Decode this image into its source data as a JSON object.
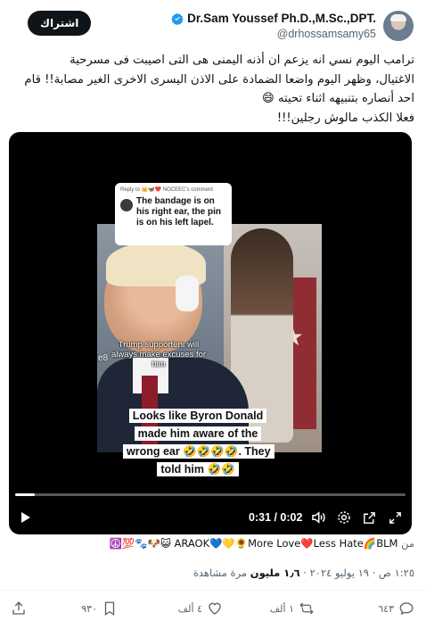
{
  "author": {
    "display_name": "Dr.Sam Youssef Ph.D.,M.Sc.,DPT.",
    "handle": "@drhossamsamy65",
    "verified_color": "#1d9bf0"
  },
  "subscribe_label": "اشتراك",
  "tweet": {
    "lines": [
      "ترامب اليوم نسي انه يزعم ان أذنه اليمنى هى التى اصيبت فى مسرحية",
      "الاغتيال، وظهر اليوم واضعا الضمادة على الاذن اليسرى الاخرى الغير مصابة!! قام",
      "احد أنصاره بتنبيهه اثناء تحيته 😄",
      "فعلا الكذب مالوش رجلين!!!"
    ]
  },
  "video": {
    "reply_header": "Reply to 👑🦋❤️ NOCEEC's comment",
    "reply_text": "The bandage is on his right ear, the pin is on his left lapel.",
    "caption_top": "Trump supporters will always make excuses for him",
    "caption_fragment": "e8",
    "caption_bottom": "Looks like Byron Donald made him aware of the wrong ear 🤣🤣🤣🤣. They told him 🤣🤣",
    "time_display": "0:31 / 0:02",
    "progress_fraction": 0.05,
    "controls": [
      "play-icon",
      "volume-icon",
      "settings-icon",
      "external-link-icon",
      "fullscreen-icon"
    ]
  },
  "source": {
    "prefix": "من",
    "account_label": "☮️💯🐾🐶😺 ARAOK💙💛🌻More Love❤️Less Hate🌈BLM"
  },
  "meta": {
    "time": "١:٢٥ ص",
    "date": "١٩ يوليو ٢٠٢٤",
    "views_count": "١٫٦ مليون",
    "views_label": "مرة مشاهدة"
  },
  "actions": {
    "replies": "٦٤٣",
    "retweets": "١ ألف",
    "likes": "٤ ألف",
    "bookmarks": "٩٣٠"
  }
}
